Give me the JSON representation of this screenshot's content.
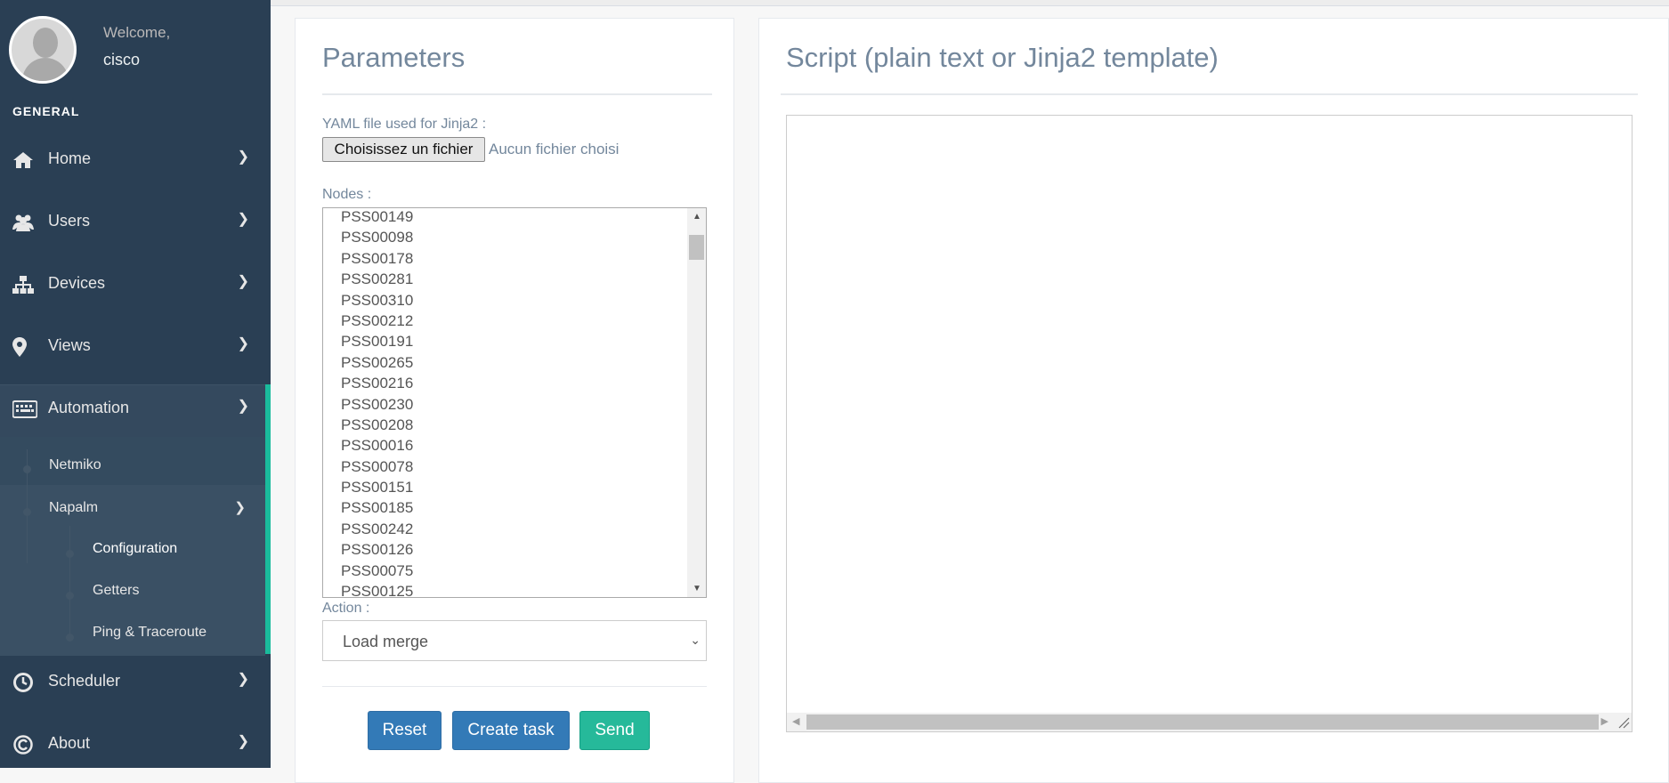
{
  "sidebar": {
    "welcome": "Welcome,",
    "username": "cisco",
    "section_title": "GENERAL",
    "items": [
      {
        "label": "Home",
        "icon": "home-icon"
      },
      {
        "label": "Users",
        "icon": "users-icon"
      },
      {
        "label": "Devices",
        "icon": "sitemap-icon"
      },
      {
        "label": "Views",
        "icon": "map-marker-icon"
      },
      {
        "label": "Automation",
        "icon": "keyboard-icon"
      },
      {
        "label": "Scheduler",
        "icon": "clock-icon"
      },
      {
        "label": "About",
        "icon": "copyright-icon"
      }
    ],
    "automation_children": {
      "netmiko": "Netmiko",
      "napalm": "Napalm",
      "napalm_children": [
        "Configuration",
        "Getters",
        "Ping & Traceroute"
      ]
    },
    "accent_color": "#1abb9c",
    "background_color": "#2a3f54"
  },
  "parameters": {
    "title": "Parameters",
    "yaml_label": "YAML file used for Jinja2 :",
    "file_button": "Choisissez un fichier",
    "file_status": "Aucun fichier choisi",
    "nodes_label": "Nodes :",
    "nodes": [
      "PSS00149",
      "PSS00098",
      "PSS00178",
      "PSS00281",
      "PSS00310",
      "PSS00212",
      "PSS00191",
      "PSS00265",
      "PSS00216",
      "PSS00230",
      "PSS00208",
      "PSS00016",
      "PSS00078",
      "PSS00151",
      "PSS00185",
      "PSS00242",
      "PSS00126",
      "PSS00075",
      "PSS00125"
    ],
    "action_label": "Action :",
    "action_value": "Load merge",
    "buttons": {
      "reset": "Reset",
      "create_task": "Create task",
      "send": "Send"
    }
  },
  "script": {
    "title": "Script (plain text or Jinja2 template)",
    "content": ""
  }
}
